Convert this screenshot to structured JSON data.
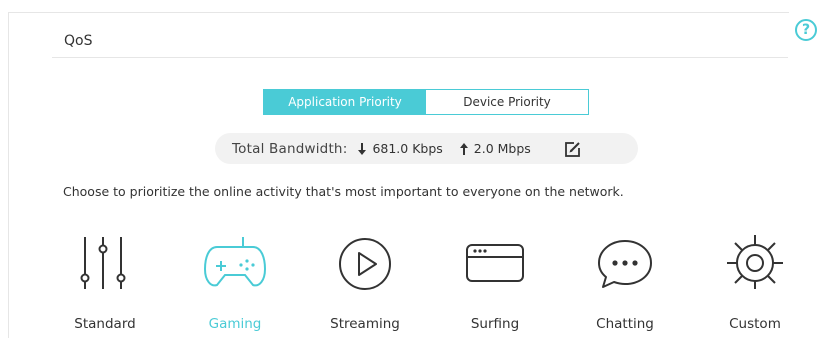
{
  "header": {
    "title": "QoS",
    "help_icon": "help-circle-icon",
    "help_glyph": "?"
  },
  "tabs": [
    {
      "label": "Application Priority",
      "active": true
    },
    {
      "label": "Device Priority",
      "active": false
    }
  ],
  "bandwidth": {
    "label": "Total Bandwidth:",
    "download": "681.0 Kbps",
    "upload": "2.0 Mbps",
    "edit_icon": "edit-icon"
  },
  "description": "Choose to prioritize the online activity that's most important to everyone on the network.",
  "modes": [
    {
      "label": "Standard",
      "icon": "sliders-icon",
      "selected": false
    },
    {
      "label": "Gaming",
      "icon": "gamepad-icon",
      "selected": true
    },
    {
      "label": "Streaming",
      "icon": "play-icon",
      "selected": false
    },
    {
      "label": "Surfing",
      "icon": "browser-window-icon",
      "selected": false
    },
    {
      "label": "Chatting",
      "icon": "chat-bubble-icon",
      "selected": false
    },
    {
      "label": "Custom",
      "icon": "gear-icon",
      "selected": false
    }
  ],
  "colors": {
    "accent": "#4acbd6",
    "text": "#333333",
    "bandwidth_bg": "#f2f2f2"
  }
}
